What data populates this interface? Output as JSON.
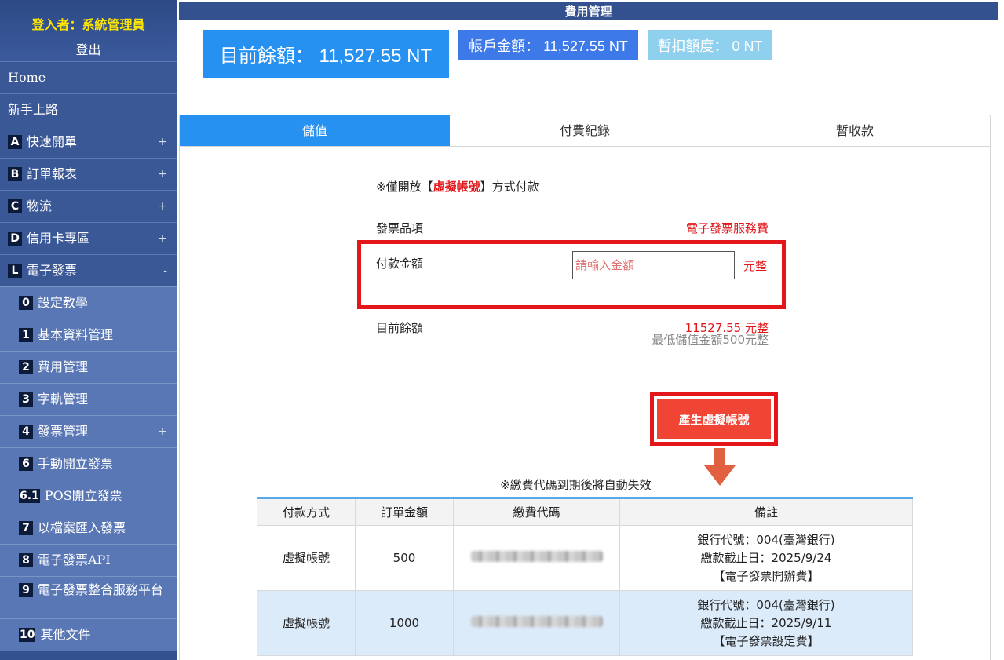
{
  "sidebar": {
    "login_user": "登入者：系統管理員",
    "logout": "登出",
    "items": [
      {
        "badge": "",
        "label": "Home",
        "toggle": ""
      },
      {
        "badge": "",
        "label": "新手上路",
        "toggle": ""
      },
      {
        "badge": "A",
        "label": "快速開單",
        "toggle": "+"
      },
      {
        "badge": "B",
        "label": "訂單報表",
        "toggle": "+"
      },
      {
        "badge": "C",
        "label": "物流",
        "toggle": "+"
      },
      {
        "badge": "D",
        "label": "信用卡專區",
        "toggle": "+"
      },
      {
        "badge": "L",
        "label": "電子發票",
        "toggle": "-"
      }
    ],
    "sub_items": [
      {
        "badge": "0",
        "label": "設定教學",
        "toggle": ""
      },
      {
        "badge": "1",
        "label": "基本資料管理",
        "toggle": ""
      },
      {
        "badge": "2",
        "label": "費用管理",
        "toggle": ""
      },
      {
        "badge": "3",
        "label": "字軌管理",
        "toggle": ""
      },
      {
        "badge": "4",
        "label": "發票管理",
        "toggle": "+"
      },
      {
        "badge": "6",
        "label": "手動開立發票",
        "toggle": ""
      },
      {
        "badge": "6.1",
        "label": "POS開立發票",
        "toggle": ""
      },
      {
        "badge": "7",
        "label": "以檔案匯入發票",
        "toggle": ""
      },
      {
        "badge": "8",
        "label": "電子發票API",
        "toggle": ""
      },
      {
        "badge": "9",
        "label": "電子發票整合服務平台",
        "toggle": ""
      },
      {
        "badge": "10",
        "label": "其他文件",
        "toggle": ""
      }
    ]
  },
  "page": {
    "title": "費用管理",
    "balance_main": "目前餘額： 11,527.55  NT",
    "balance_account": "帳戶金額： 11,527.55  NT",
    "balance_hold": "暫扣額度： 0  NT"
  },
  "tabs": [
    {
      "label": "儲值"
    },
    {
      "label": "付費紀錄"
    },
    {
      "label": "暫收款"
    }
  ],
  "form": {
    "notice_prefix": "※僅開放【",
    "notice_highlight": "虛擬帳號",
    "notice_suffix": "】方式付款",
    "item_label": "發票品項",
    "item_value": "電子發票服務費",
    "amount_label": "付款金額",
    "amount_placeholder": "請輸入金額",
    "amount_unit": "元整",
    "min_note": "最低儲值金額500元整",
    "balance_label": "目前餘額",
    "balance_value": "11527.55  元整",
    "generate_button": "產生虛擬帳號",
    "expire_note": "※繳費代碼到期後將自動失效"
  },
  "table": {
    "headers": [
      "付款方式",
      "訂單金額",
      "繳費代碼",
      "備註"
    ],
    "rows": [
      {
        "method": "虛擬帳號",
        "amount": "500",
        "bank": "銀行代號：004(臺灣銀行)",
        "due": "繳款截止日：2025/9/24",
        "memo": "【電子發票開辦費】"
      },
      {
        "method": "虛擬帳號",
        "amount": "1000",
        "bank": "銀行代號：004(臺灣銀行)",
        "due": "繳款截止日：2025/9/11",
        "memo": "【電子發票設定費】"
      }
    ]
  }
}
